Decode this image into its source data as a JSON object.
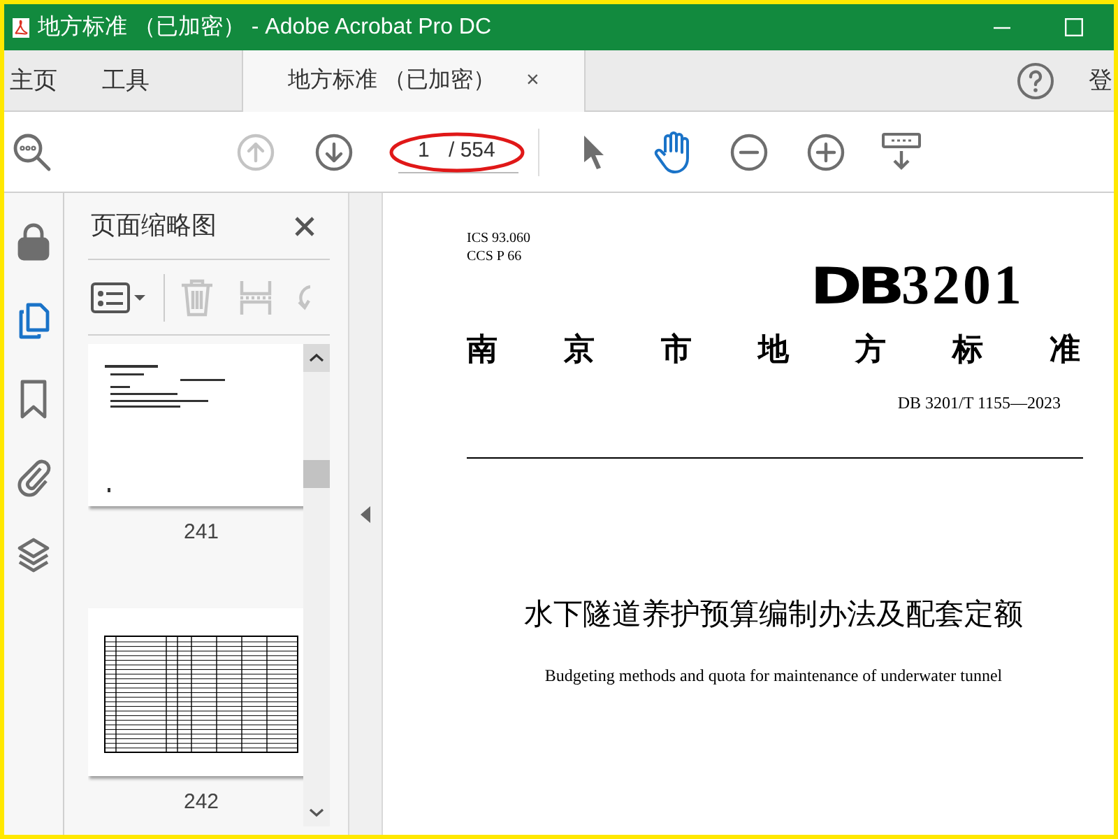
{
  "window": {
    "title": "地方标准 （已加密） - Adobe Acrobat Pro DC"
  },
  "tabs": [
    {
      "label": "主页",
      "selected": false
    },
    {
      "label": "工具",
      "selected": false
    },
    {
      "label": "地方标准 （已加密）",
      "selected": true,
      "close": "×"
    }
  ],
  "account": {
    "label": "登"
  },
  "toolbar": {
    "page_value": "1",
    "page_total": "/ 554"
  },
  "rail": [
    {
      "kind": "lock",
      "selected": false
    },
    {
      "kind": "pages",
      "selected": true
    },
    {
      "kind": "bookmark",
      "selected": false
    },
    {
      "kind": "attach",
      "selected": false
    },
    {
      "kind": "layers",
      "selected": false
    }
  ],
  "thumbnails_panel": {
    "title": "页面缩略图",
    "items": [
      {
        "label": "241",
        "kind": "text"
      },
      {
        "label": "242",
        "kind": "table"
      }
    ]
  },
  "document": {
    "ics": "ICS  93.060",
    "ccs": "CCS  P 66",
    "code_prefix": "DB",
    "code_number": "3201",
    "issuer": "南京市地方标准",
    "number": "DB 3201/T  1155—2023",
    "title": "水下隧道养护预算编制办法及配套定额",
    "subtitle": "Budgeting methods and quota for maintenance of underwater tunnel"
  }
}
